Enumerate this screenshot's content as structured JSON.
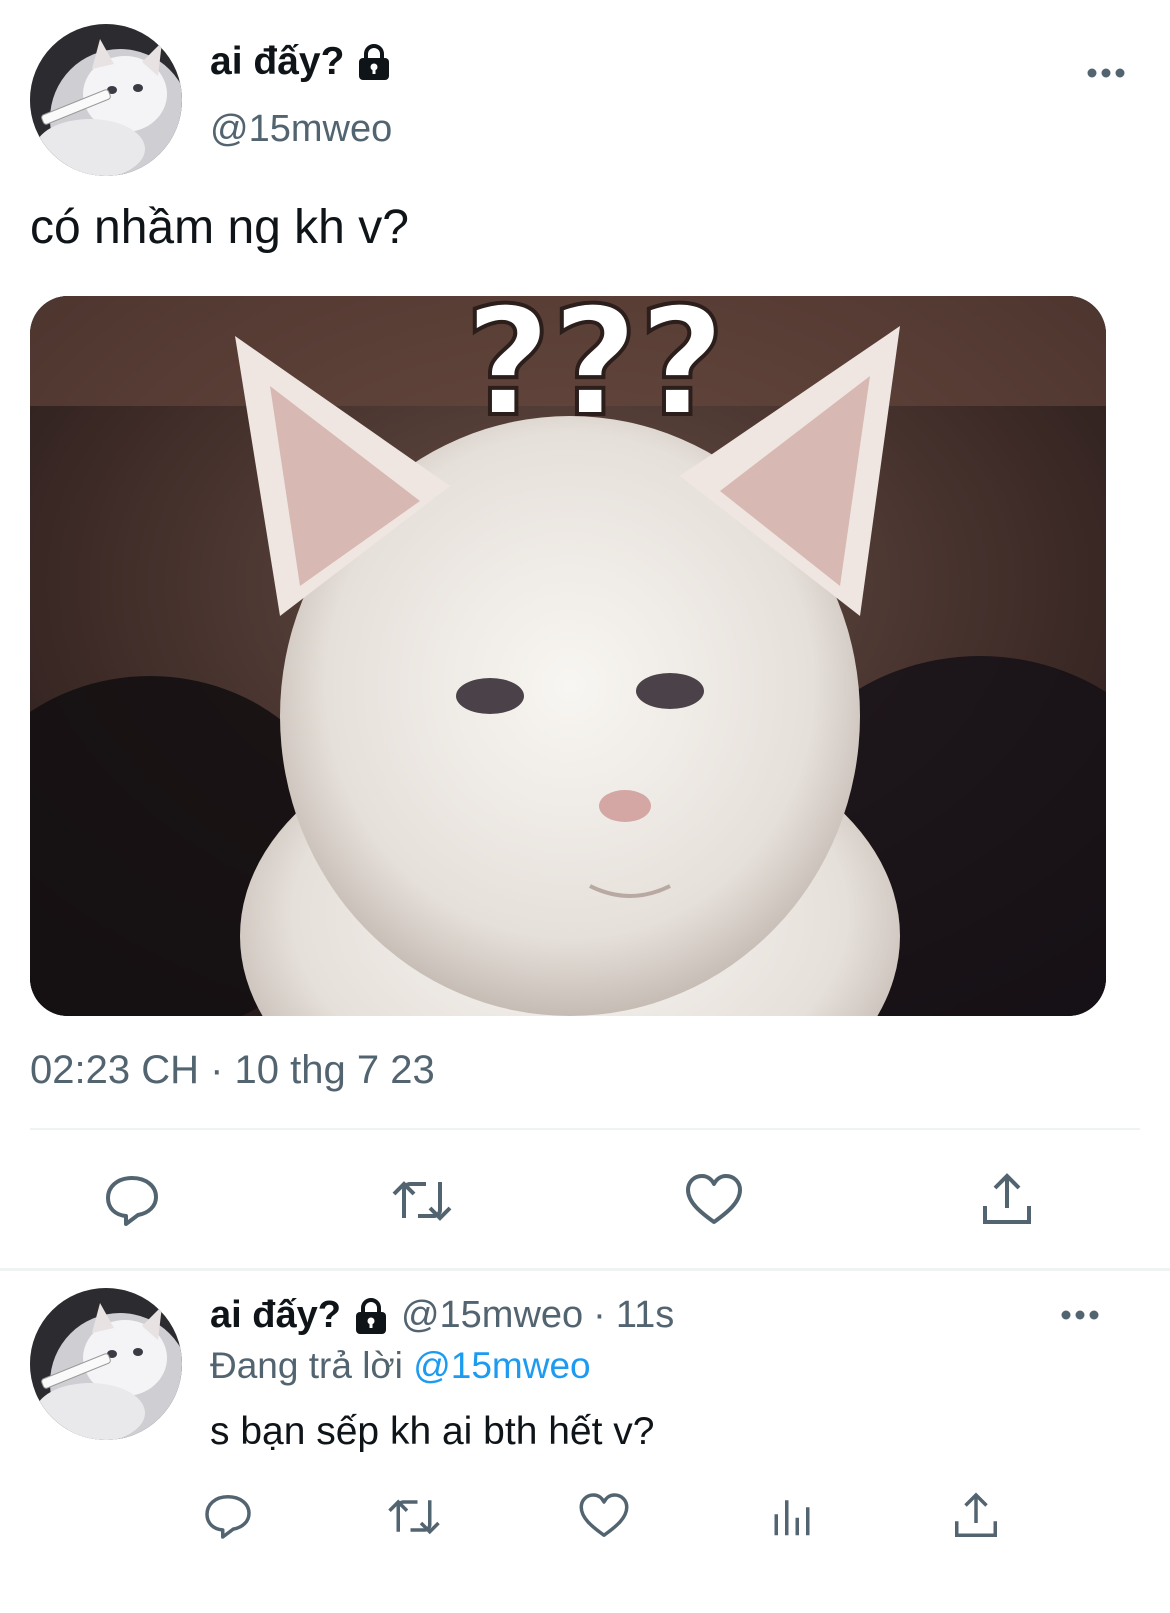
{
  "tweet": {
    "author": {
      "name": "ai đấy?",
      "handle": "@15mweo",
      "protected_icon": "lock-icon",
      "avatar_icon": "white-cat-with-cigarette-avatar"
    },
    "text": "có nhầm ng kh v?",
    "media": {
      "kind": "image",
      "overlay_text": "???",
      "description_icon": "confused-white-cat-meme"
    },
    "timestamp": "02:23 CH · 10 thg 7 23",
    "actions": [
      "reply-icon",
      "retweet-icon",
      "like-icon",
      "share-icon"
    ],
    "more_icon": "more-icon"
  },
  "reply": {
    "author": {
      "name": "ai đấy?",
      "handle": "@15mweo",
      "protected_icon": "lock-icon"
    },
    "separator": "·",
    "time": "11s",
    "replying_prefix": "Đang trả lời",
    "replying_to": "@15mweo",
    "text": "s bạn sếp kh ai bth hết v?",
    "actions": [
      "reply-icon",
      "retweet-icon",
      "like-icon",
      "views-icon",
      "share-icon"
    ],
    "more_icon": "more-icon"
  },
  "colors": {
    "text_primary": "#0f1419",
    "text_secondary": "#536471",
    "link": "#1d9bf0",
    "divider": "#eff3f4",
    "icon": "#536471"
  }
}
